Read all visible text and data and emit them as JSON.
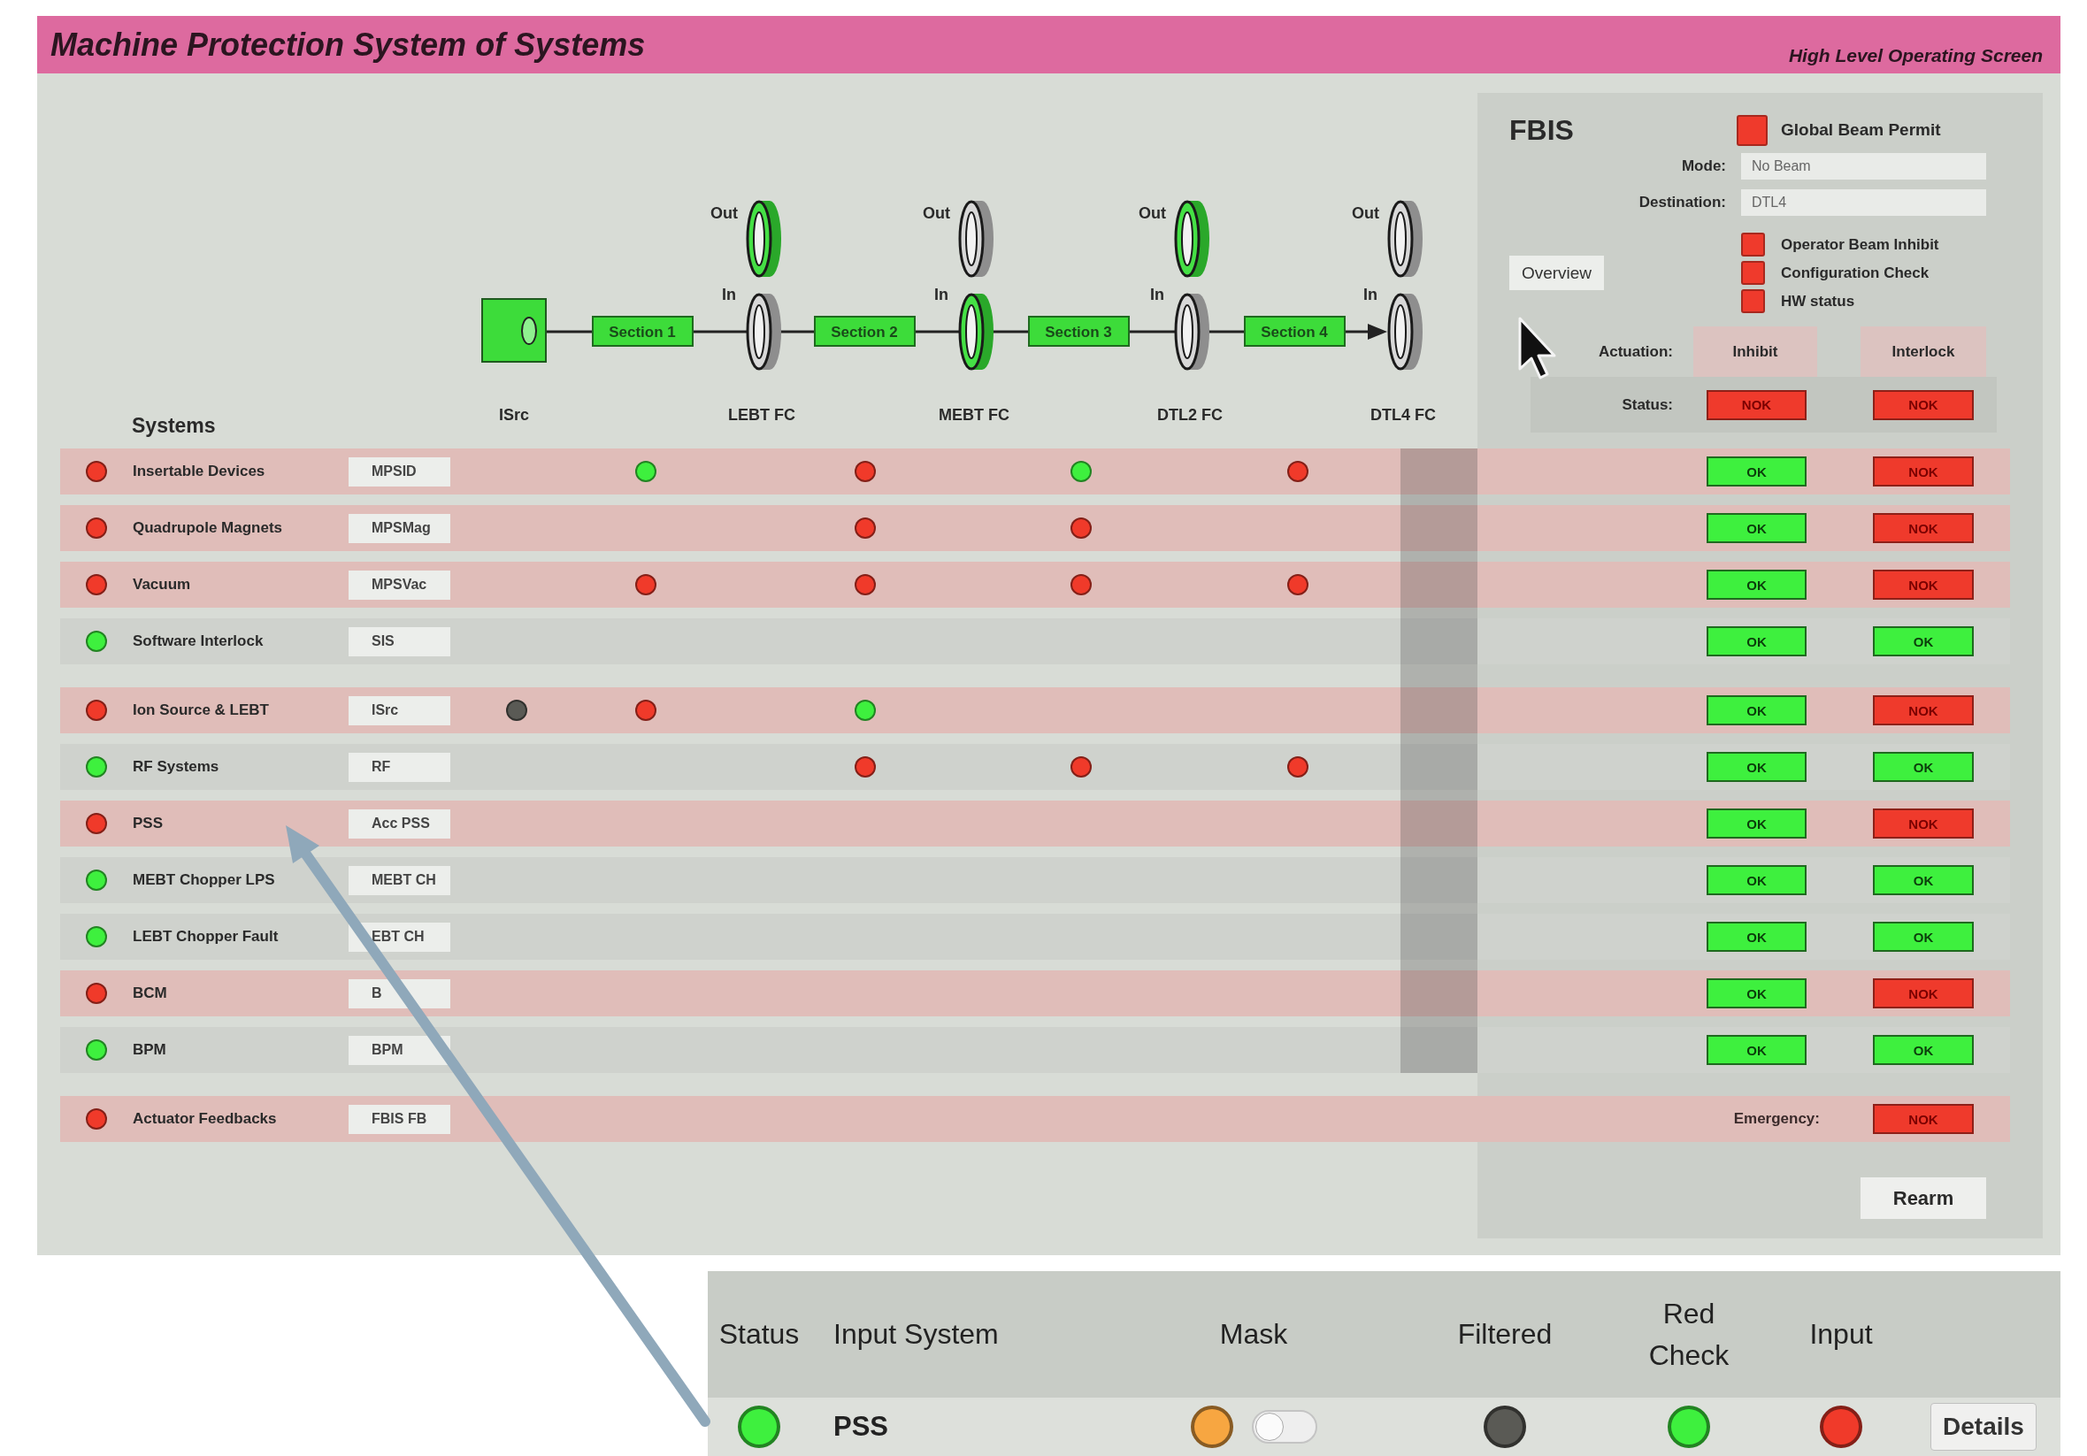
{
  "header": {
    "title": "Machine Protection System of Systems",
    "subtitle": "High Level Operating Screen"
  },
  "diagram": {
    "source": {
      "name": "ISrc"
    },
    "sections": [
      "Section 1",
      "Section 2",
      "Section 3",
      "Section 4"
    ],
    "faraday_cups": [
      {
        "name": "LEBT FC",
        "out_label": "Out",
        "in_label": "In",
        "out_active": true,
        "in_active": false
      },
      {
        "name": "MEBT FC",
        "out_label": "Out",
        "in_label": "In",
        "out_active": false,
        "in_active": true
      },
      {
        "name": "DTL2 FC",
        "out_label": "Out",
        "in_label": "In",
        "out_active": true,
        "in_active": false
      },
      {
        "name": "DTL4 FC",
        "out_label": "Out",
        "in_label": "In",
        "out_active": false,
        "in_active": false
      }
    ],
    "systems_label": "Systems"
  },
  "fbis": {
    "title": "FBIS",
    "global_beam_permit": {
      "label": "Global Beam Permit",
      "ok": false
    },
    "mode": {
      "label": "Mode:",
      "value": "No Beam"
    },
    "destination": {
      "label": "Destination:",
      "value": "DTL4"
    },
    "overview_button": "Overview",
    "indicators": [
      {
        "label": "Operator Beam Inhibit",
        "ok": false
      },
      {
        "label": "Configuration Check",
        "ok": false
      },
      {
        "label": "HW status",
        "ok": false
      }
    ],
    "actuation_label": "Actuation:",
    "columns": [
      "Inhibit",
      "Interlock"
    ],
    "status_label": "Status:",
    "status": [
      {
        "label": "NOK",
        "ok": false
      },
      {
        "label": "NOK",
        "ok": false
      }
    ],
    "rearm_button": "Rearm"
  },
  "system_groups": [
    {
      "rows": [
        {
          "ok": false,
          "name": "Insertable Devices",
          "system": "MPSID",
          "points": [
            {
              "lit": false
            },
            {
              "lit": true,
              "color": "#3ef03e"
            },
            {
              "lit": true,
              "color": "#f03a2a"
            },
            {
              "lit": true,
              "color": "#3ef03e"
            },
            {
              "lit": true,
              "color": "#f03a2a"
            }
          ],
          "inhibit": {
            "label": "OK",
            "ok": true
          },
          "interlock": {
            "label": "NOK",
            "ok": false
          }
        },
        {
          "ok": false,
          "name": "Quadrupole Magnets",
          "system": "MPSMag",
          "points": [
            {
              "lit": false
            },
            {
              "lit": false
            },
            {
              "lit": true,
              "color": "#f03a2a"
            },
            {
              "lit": true,
              "color": "#f03a2a"
            },
            {
              "lit": false
            }
          ],
          "inhibit": {
            "label": "OK",
            "ok": true
          },
          "interlock": {
            "label": "NOK",
            "ok": false
          }
        },
        {
          "ok": false,
          "name": "Vacuum",
          "system": "MPSVac",
          "points": [
            {
              "lit": false
            },
            {
              "lit": true,
              "color": "#f03a2a"
            },
            {
              "lit": true,
              "color": "#f03a2a"
            },
            {
              "lit": true,
              "color": "#f03a2a"
            },
            {
              "lit": true,
              "color": "#f03a2a"
            }
          ],
          "inhibit": {
            "label": "OK",
            "ok": true
          },
          "interlock": {
            "label": "NOK",
            "ok": false
          }
        },
        {
          "ok": true,
          "name": "Software Interlock",
          "system": "SIS",
          "inhibit": {
            "label": "OK",
            "ok": true
          },
          "interlock": {
            "label": "OK",
            "ok": true
          }
        }
      ]
    },
    {
      "rows": [
        {
          "ok": false,
          "name": "Ion Source & LEBT",
          "system": "ISrc",
          "points": [
            {
              "lit": true,
              "color": "#5a5a55"
            },
            {
              "lit": true,
              "color": "#f03a2a"
            },
            {
              "lit": true,
              "color": "#3ef03e"
            }
          ],
          "inhibit": {
            "label": "OK",
            "ok": true
          },
          "interlock": {
            "label": "NOK",
            "ok": false
          }
        },
        {
          "ok": true,
          "name": "RF Systems",
          "system": "RF",
          "points": [
            {
              "lit": false
            },
            {
              "lit": false
            },
            {
              "lit": true,
              "color": "#f03a2a"
            },
            {
              "lit": true,
              "color": "#f03a2a"
            },
            {
              "lit": true,
              "color": "#f03a2a"
            }
          ],
          "inhibit": {
            "label": "OK",
            "ok": true
          },
          "interlock": {
            "label": "OK",
            "ok": true
          }
        },
        {
          "ok": false,
          "name": "PSS",
          "system": "Acc PSS",
          "inhibit": {
            "label": "OK",
            "ok": true
          },
          "interlock": {
            "label": "NOK",
            "ok": false
          }
        },
        {
          "ok": true,
          "name": "MEBT Chopper LPS",
          "system": "MEBT CH",
          "inhibit": {
            "label": "OK",
            "ok": true
          },
          "interlock": {
            "label": "OK",
            "ok": true
          }
        },
        {
          "ok": true,
          "name": "LEBT Chopper Fault",
          "system": "EBT CH",
          "inhibit": {
            "label": "OK",
            "ok": true
          },
          "interlock": {
            "label": "OK",
            "ok": true
          }
        },
        {
          "ok": false,
          "name": "BCM",
          "system": "B",
          "inhibit": {
            "label": "OK",
            "ok": true
          },
          "interlock": {
            "label": "NOK",
            "ok": false
          }
        },
        {
          "ok": true,
          "name": "BPM",
          "system": "BPM",
          "inhibit": {
            "label": "OK",
            "ok": true
          },
          "interlock": {
            "label": "OK",
            "ok": true
          }
        }
      ]
    },
    {
      "rows": [
        {
          "ok": false,
          "name": "Actuator Feedbacks",
          "system": "FBIS FB",
          "emergency_label": "Emergency:",
          "interlock": {
            "label": "NOK",
            "ok": false
          }
        }
      ]
    }
  ],
  "detail": {
    "columns": [
      "Status",
      "Input System",
      "Mask",
      "Filtered",
      "Red Check",
      "Input"
    ],
    "row": {
      "status": {
        "color": "#3ef03e"
      },
      "system": "PSS",
      "mask": {
        "color": "#f7a641",
        "on": false
      },
      "filtered": {
        "color": "#5a5a55"
      },
      "red_check": {
        "color": "#3ef03e"
      },
      "input": {
        "color": "#f03a2a"
      },
      "details_button": "Details"
    }
  }
}
